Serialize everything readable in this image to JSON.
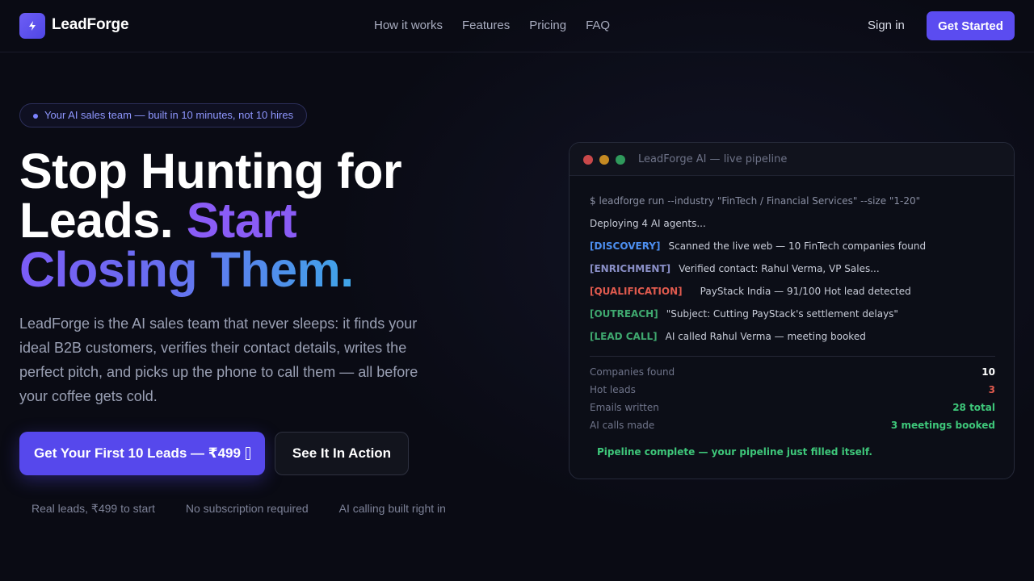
{
  "brand": {
    "name": "LeadForge",
    "logo_text": "LeadForge"
  },
  "nav": {
    "links": [
      "How it works",
      "Features",
      "Pricing",
      "FAQ"
    ],
    "signin": "Sign in",
    "cta": "Get Started"
  },
  "hero": {
    "badge": "Your AI sales team — built in 10 minutes, not 10 hires",
    "headline_part1": "Stop Hunting for Leads.",
    "headline_part2": "Start",
    "headline_part3": "Closing Them.",
    "subcopy": "LeadForge is the AI sales team that never sleeps: it finds your ideal B2B customers, verifies their contact details, writes the perfect pitch, and picks up the phone to call them — all before your coffee gets cold.",
    "cta_primary": "Get Your First 10 Leads — ₹499",
    "cta_secondary": "See It In Action",
    "perks": [
      "Real leads, ₹499 to start",
      "No subscription required",
      "AI calling built right in"
    ]
  },
  "terminal": {
    "title": "LeadForge AI — live pipeline",
    "command": "$ leadforge run --industry \"FinTech / Financial Services\" --size \"1-20\"",
    "deploying": "Deploying 4 AI agents...",
    "steps": [
      {
        "tag": "[DISCOVERY]",
        "text": "Scanned the live web — 10 FinTech companies found"
      },
      {
        "tag": "[ENRICHMENT]",
        "text": "Verified contact: Rahul Verma, VP Sales..."
      },
      {
        "tag": "[QUALIFICATION]",
        "text": "PayStack India — 91/100 Hot lead detected"
      },
      {
        "tag": "[OUTREACH]",
        "text": "\"Subject: Cutting PayStack's settlement delays\""
      },
      {
        "tag": "[LEAD CALL]",
        "text": "AI called Rahul Verma — meeting booked"
      }
    ],
    "stats": [
      {
        "label": "Companies found",
        "value": "10",
        "color": "#ffffff"
      },
      {
        "label": "Hot leads",
        "value": "3",
        "color": "#e05a4e"
      },
      {
        "label": "Emails written",
        "value": "28 total",
        "color": "#3ec77a"
      },
      {
        "label": "AI calls made",
        "value": "3 meetings booked",
        "color": "#3ec77a"
      }
    ],
    "complete": "Pipeline complete — your pipeline just filled itself."
  }
}
